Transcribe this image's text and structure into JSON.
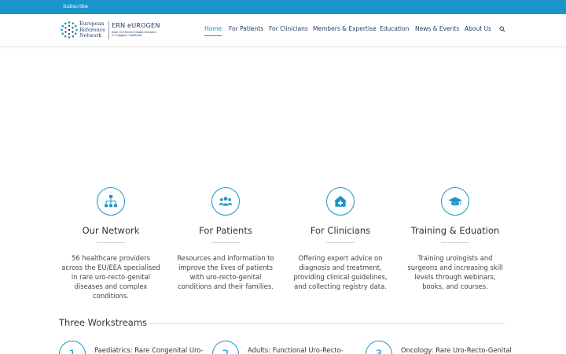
{
  "topbar": {
    "subscribe": "Subscribe"
  },
  "logo": {
    "ern_lines": [
      "European",
      "Reference",
      "Network"
    ],
    "brand": "ERN eUROGEN",
    "brand_sub_lines": [
      "Rare Uro-Recto-Genital Diseases",
      "& Complex Conditions"
    ]
  },
  "nav": {
    "items": [
      "Home",
      "For Patients",
      "For Clinicians",
      "Members & Expertise",
      "Education",
      "News & Events",
      "About Us"
    ],
    "active": "Home"
  },
  "features": [
    {
      "icon": "network-icon",
      "title": "Our Network",
      "desc_lines": [
        "56 healthcare providers",
        "across the EU/EEA specialised",
        "in rare uro-recto-genital",
        "diseases and complex",
        "conditions."
      ]
    },
    {
      "icon": "patients-icon",
      "title": "For Patients",
      "desc_lines": [
        "Resources and information to",
        "improve the lives of patients",
        "with uro-recto-genital",
        "conditions and their families."
      ]
    },
    {
      "icon": "clinic-icon",
      "title": "For Clinicians",
      "desc_lines": [
        "Offering expert advice on",
        "diagnosis and treatment,",
        "providing clinical guidelines,",
        "and collecting registry data."
      ]
    },
    {
      "icon": "graduation-cap-icon",
      "title": "Training & Eduation",
      "desc_lines": [
        "Training urologists and",
        "surgeons and increasing skill",
        "levels through webinars,",
        "books, and courses."
      ]
    }
  ],
  "workstreams": {
    "title": "Three Workstreams",
    "items": [
      {
        "num": "1",
        "title": "Paediatrics: Rare Congenital Uro-"
      },
      {
        "num": "2",
        "title": "Adults: Functional Uro-Recto-"
      },
      {
        "num": "3",
        "title": "Oncology: Rare Uro-Recto-Genital"
      }
    ]
  },
  "colors": {
    "accent": "#1a95c9",
    "navy": "#1f3a5f"
  }
}
